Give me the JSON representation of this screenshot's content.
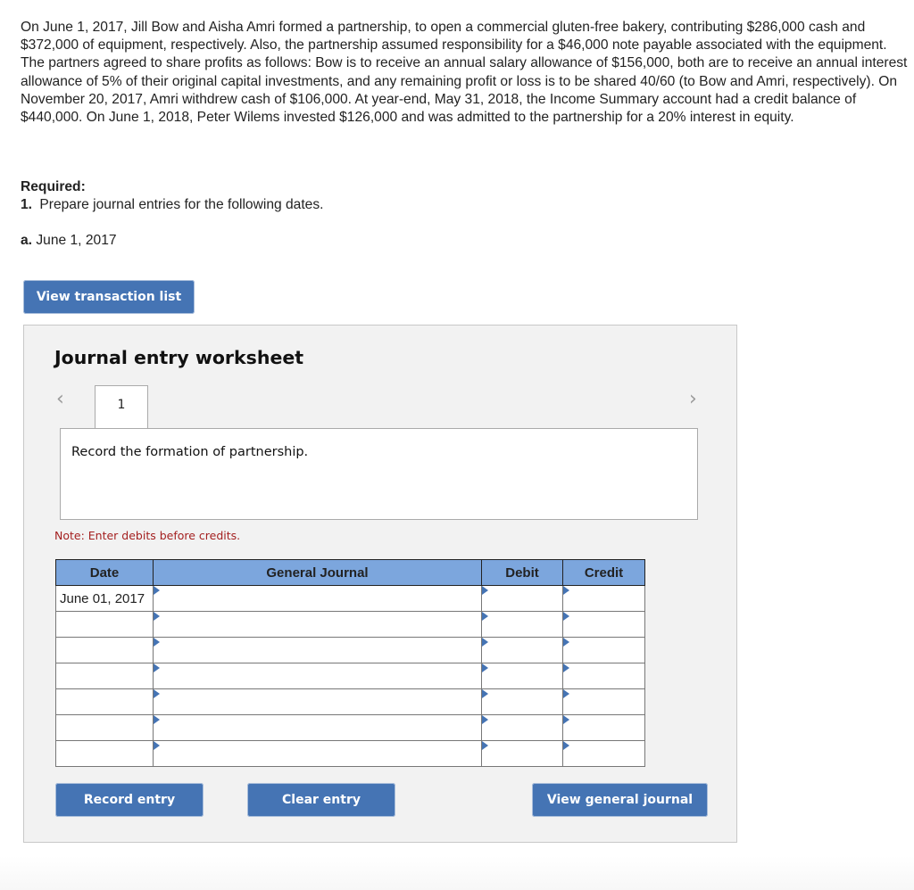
{
  "problem": {
    "text": "On June 1, 2017, Jill Bow and Aisha Amri formed a partnership, to open a commercial gluten-free bakery, contributing $286,000 cash and $372,000 of equipment, respectively. Also, the partnership assumed responsibility for a $46,000 note payable associated with the equipment. The partners agreed to share profits as follows: Bow is to receive an annual salary allowance of $156,000, both are to receive an annual interest allowance of 5% of their original capital investments, and any remaining profit or loss is to be shared 40/60 (to Bow and Amri, respectively). On November 20, 2017, Amri withdrew cash of $106,000. At year-end, May 31, 2018, the Income Summary account had a credit balance of $440,000. On June 1, 2018, Peter Wilems invested $126,000 and was admitted to the partnership for a 20% interest in equity."
  },
  "required": {
    "title": "Required:",
    "item_number": "1.",
    "item_text": "Prepare journal entries for the following dates.",
    "sub_label": "a.",
    "sub_text": "June 1, 2017"
  },
  "buttons": {
    "view_transaction_list": "View transaction list",
    "record_entry": "Record entry",
    "clear_entry": "Clear entry",
    "view_general_journal": "View general journal"
  },
  "worksheet": {
    "title": "Journal entry worksheet",
    "prev_icon": "‹",
    "next_icon": "›",
    "tabs": [
      {
        "label": "1"
      }
    ],
    "description": "Record the formation of partnership.",
    "note": "Note: Enter debits before credits.",
    "columns": [
      "Date",
      "General Journal",
      "Debit",
      "Credit"
    ],
    "rows": [
      {
        "date": "June 01, 2017",
        "account": "",
        "debit": "",
        "credit": ""
      },
      {
        "date": "",
        "account": "",
        "debit": "",
        "credit": ""
      },
      {
        "date": "",
        "account": "",
        "debit": "",
        "credit": ""
      },
      {
        "date": "",
        "account": "",
        "debit": "",
        "credit": ""
      },
      {
        "date": "",
        "account": "",
        "debit": "",
        "credit": ""
      },
      {
        "date": "",
        "account": "",
        "debit": "",
        "credit": ""
      },
      {
        "date": "",
        "account": "",
        "debit": "",
        "credit": ""
      }
    ]
  },
  "colors": {
    "button_blue": "#4574b4",
    "table_header": "#7ca6dd",
    "note_red": "#a42020",
    "panel_bg": "#f2f2f2"
  }
}
